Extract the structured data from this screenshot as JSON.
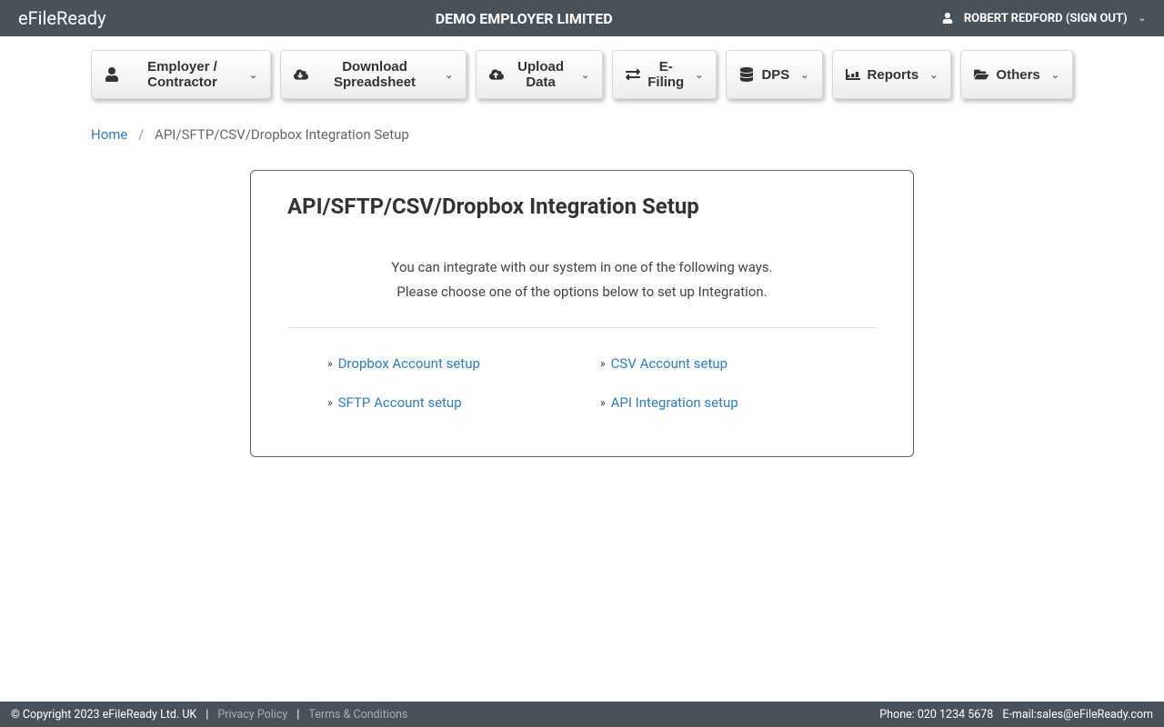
{
  "header": {
    "brand": "eFileReady",
    "company": "DEMO EMPLOYER LIMITED",
    "user": "ROBERT REDFORD (SIGN OUT)"
  },
  "nav": {
    "employer": "Employer / Contractor",
    "download": "Download Spreadsheet",
    "upload": "Upload Data",
    "efiling": "E-Filing",
    "dps": "DPS",
    "reports": "Reports",
    "others": "Others"
  },
  "breadcrumb": {
    "home": "Home",
    "current": "API/SFTP/CSV/Dropbox Integration Setup"
  },
  "panel": {
    "title": "API/SFTP/CSV/Dropbox Integration Setup",
    "intro_line1": "You can integrate with our system in one of the following ways.",
    "intro_line2": "Please choose one of the options below to set up Integration.",
    "links": {
      "dropbox": "Dropbox Account setup",
      "csv": "CSV Account setup",
      "sftp": "SFTP Account setup",
      "api": "API Integration setup"
    }
  },
  "footer": {
    "copyright": "© Copyright 2023  eFileReady Ltd. UK",
    "privacy": "Privacy Policy",
    "terms": "Terms & Conditions",
    "phone_label": "Phone: ",
    "phone": "020 1234 5678",
    "email_label": "E-mail:",
    "email": "sales@eFileReady.com"
  }
}
